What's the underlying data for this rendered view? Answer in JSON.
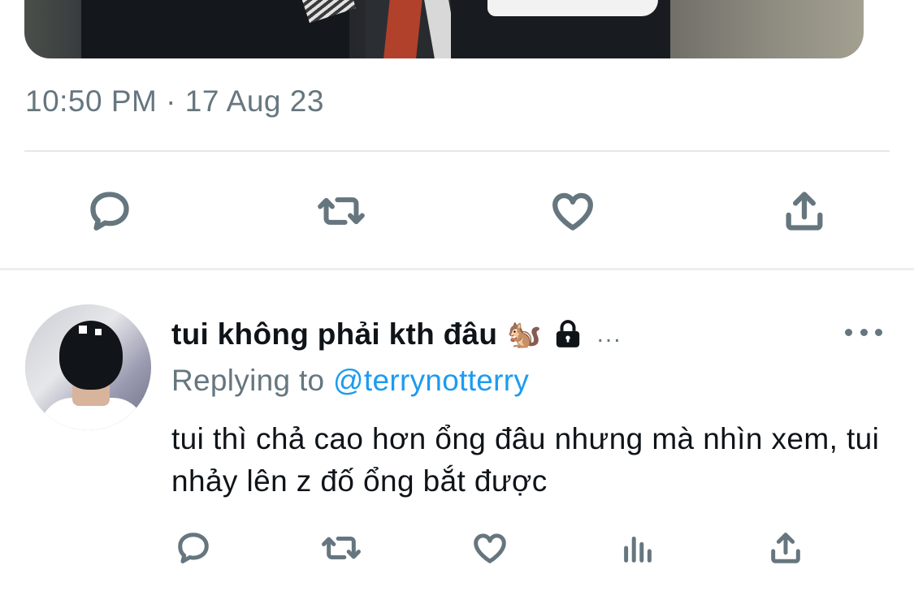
{
  "tweet": {
    "timestamp": "10:50 PM · 17 Aug 23",
    "actions": [
      {
        "name": "reply",
        "icon": "reply-icon"
      },
      {
        "name": "retweet",
        "icon": "retweet-icon"
      },
      {
        "name": "like",
        "icon": "heart-icon"
      },
      {
        "name": "share",
        "icon": "share-icon"
      }
    ]
  },
  "reply": {
    "display_name": "tui không phải kth đâu",
    "name_emoji": "🐿️",
    "lock_icon": "lock-icon",
    "name_overflow": "...",
    "replying_prefix": "Replying to",
    "replying_handle": "@terrynotterry",
    "text": "tui thì chả cao hơn ổng đâu nhưng mà nhìn xem, tui nhảy lên z đố ổng bắt được",
    "actions": [
      {
        "name": "reply",
        "icon": "reply-icon"
      },
      {
        "name": "retweet",
        "icon": "retweet-icon"
      },
      {
        "name": "like",
        "icon": "heart-icon"
      },
      {
        "name": "views",
        "icon": "analytics-icon"
      },
      {
        "name": "share",
        "icon": "share-icon"
      }
    ]
  },
  "colors": {
    "text_primary": "#0f1419",
    "text_secondary": "#66767f",
    "link": "#1d9bf0",
    "divider": "#e4e7ea"
  }
}
